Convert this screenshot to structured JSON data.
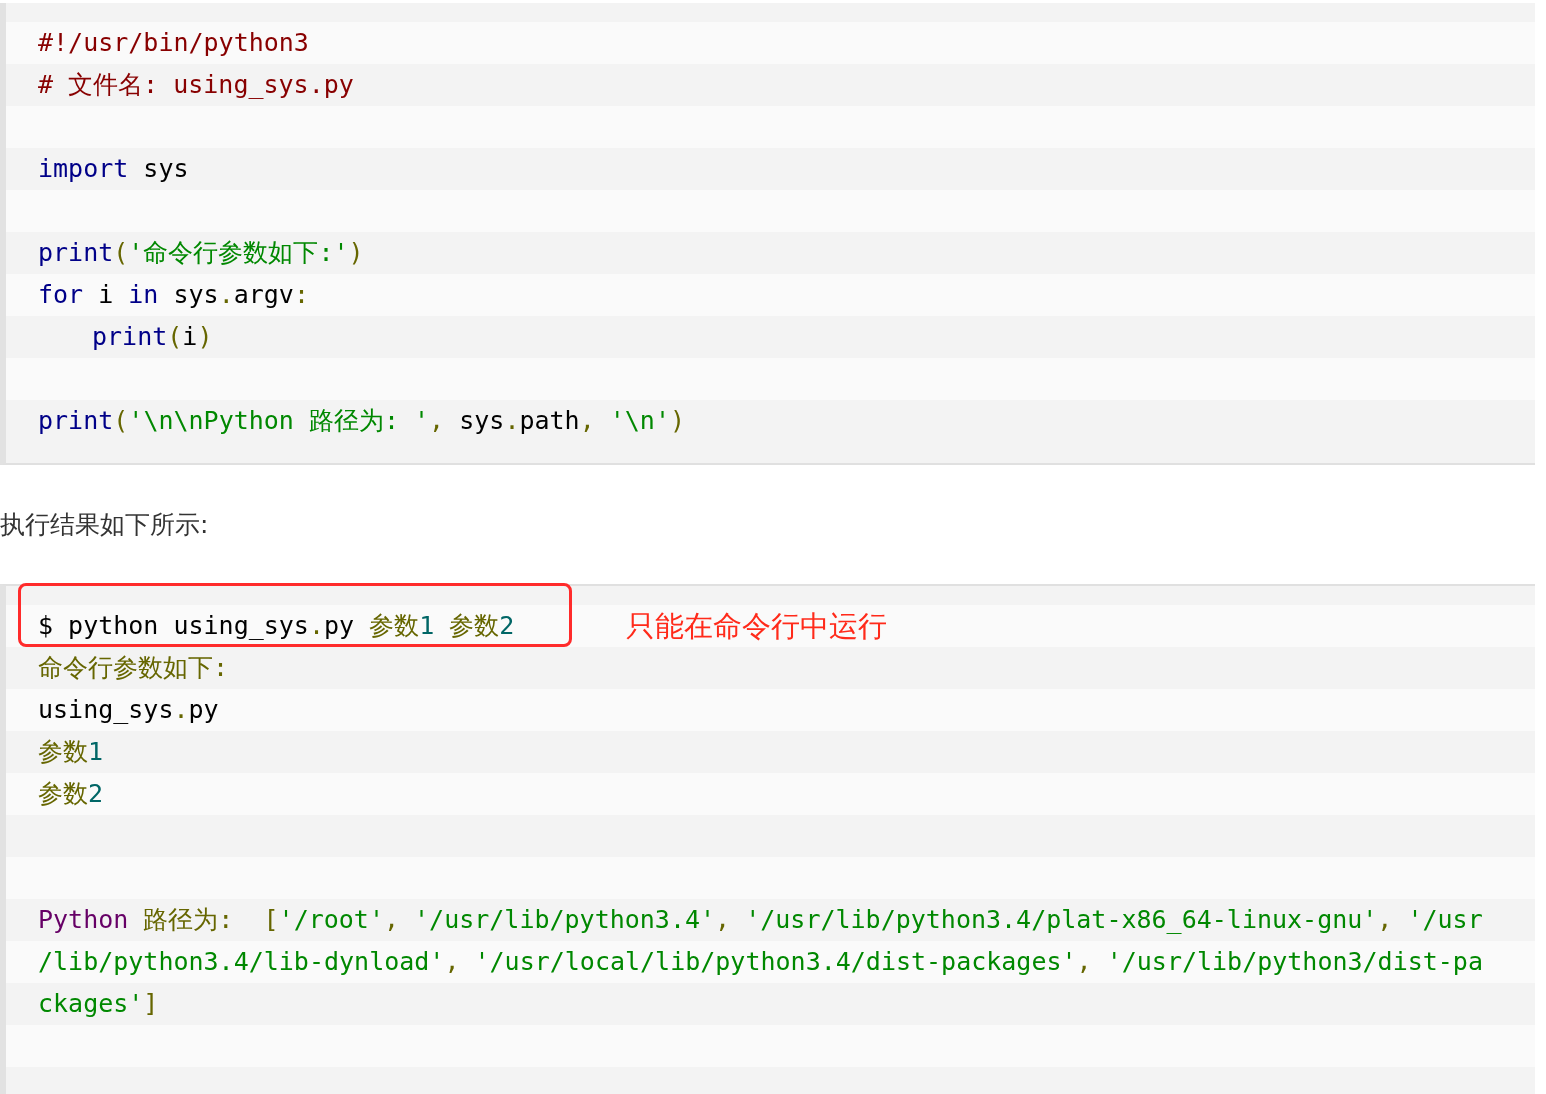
{
  "source_code": {
    "lines": [
      {
        "kind": "code",
        "tokens": [
          {
            "text": "#!/usr/bin/python3",
            "kind": "com"
          }
        ]
      },
      {
        "kind": "code",
        "tokens": [
          {
            "text": "# 文件名: using_sys.py",
            "kind": "com"
          }
        ]
      },
      {
        "kind": "blank"
      },
      {
        "kind": "code",
        "tokens": [
          {
            "text": "import",
            "kind": "kwd"
          },
          {
            "text": " sys",
            "kind": "pln"
          }
        ]
      },
      {
        "kind": "blank"
      },
      {
        "kind": "code",
        "tokens": [
          {
            "text": "print",
            "kind": "kwd"
          },
          {
            "text": "(",
            "kind": "pun"
          },
          {
            "text": "'命令行参数如下:'",
            "kind": "str"
          },
          {
            "text": ")",
            "kind": "pun"
          }
        ]
      },
      {
        "kind": "code",
        "tokens": [
          {
            "text": "for",
            "kind": "kwd"
          },
          {
            "text": " i ",
            "kind": "pln"
          },
          {
            "text": "in",
            "kind": "kwd"
          },
          {
            "text": " sys",
            "kind": "pln"
          },
          {
            "text": ".",
            "kind": "pun"
          },
          {
            "text": "argv",
            "kind": "pln"
          },
          {
            "text": ":",
            "kind": "pun"
          }
        ]
      },
      {
        "kind": "indented",
        "tokens": [
          {
            "text": "print",
            "kind": "kwd"
          },
          {
            "text": "(",
            "kind": "pun"
          },
          {
            "text": "i",
            "kind": "pln"
          },
          {
            "text": ")",
            "kind": "pun"
          }
        ]
      },
      {
        "kind": "blank"
      },
      {
        "kind": "code",
        "tokens": [
          {
            "text": "print",
            "kind": "kwd"
          },
          {
            "text": "(",
            "kind": "pun"
          },
          {
            "text": "'\\n\\nPython 路径为: '",
            "kind": "str"
          },
          {
            "text": ", ",
            "kind": "pun"
          },
          {
            "text": "sys",
            "kind": "pln"
          },
          {
            "text": ".",
            "kind": "pun"
          },
          {
            "text": "path",
            "kind": "pln"
          },
          {
            "text": ", ",
            "kind": "pun"
          },
          {
            "text": "'\\n'",
            "kind": "str"
          },
          {
            "text": ")",
            "kind": "pun"
          }
        ]
      }
    ]
  },
  "paragraph": "执行结果如下所示:",
  "output": {
    "annotation": "只能在命令行中运行",
    "lines": [
      {
        "kind": "code",
        "boxed": true,
        "tokens": [
          {
            "text": "$ python using_sys",
            "kind": "pln"
          },
          {
            "text": ".",
            "kind": "pun"
          },
          {
            "text": "py ",
            "kind": "pln"
          },
          {
            "text": "参数",
            "kind": "pun"
          },
          {
            "text": "1 ",
            "kind": "lit"
          },
          {
            "text": "参数",
            "kind": "pun"
          },
          {
            "text": "2",
            "kind": "lit"
          }
        ]
      },
      {
        "kind": "code",
        "boxed": false,
        "tokens": [
          {
            "text": "命令行参数如下:",
            "kind": "pun"
          }
        ]
      },
      {
        "kind": "code",
        "boxed": false,
        "tokens": [
          {
            "text": "using_sys",
            "kind": "pln"
          },
          {
            "text": ".",
            "kind": "pun"
          },
          {
            "text": "py",
            "kind": "pln"
          }
        ]
      },
      {
        "kind": "code",
        "boxed": false,
        "tokens": [
          {
            "text": "参数",
            "kind": "pun"
          },
          {
            "text": "1",
            "kind": "lit"
          }
        ]
      },
      {
        "kind": "code",
        "boxed": false,
        "tokens": [
          {
            "text": "参数",
            "kind": "pun"
          },
          {
            "text": "2",
            "kind": "lit"
          }
        ]
      },
      {
        "kind": "blank"
      },
      {
        "kind": "blank"
      },
      {
        "kind": "code",
        "boxed": false,
        "tokens": [
          {
            "text": "Python ",
            "kind": "typ"
          },
          {
            "text": "路径为:  [",
            "kind": "pun"
          },
          {
            "text": "'/root'",
            "kind": "str"
          },
          {
            "text": ", ",
            "kind": "pun"
          },
          {
            "text": "'/usr/lib/python3.4'",
            "kind": "str"
          },
          {
            "text": ", ",
            "kind": "pun"
          },
          {
            "text": "'/usr/lib/python3.4/plat-x86_64-linux-gnu'",
            "kind": "str"
          },
          {
            "text": ", ",
            "kind": "pun"
          },
          {
            "text": "'/usr",
            "kind": "str"
          }
        ]
      },
      {
        "kind": "code",
        "boxed": false,
        "tokens": [
          {
            "text": "/lib/python3.4/lib-dynload'",
            "kind": "str"
          },
          {
            "text": ", ",
            "kind": "pun"
          },
          {
            "text": "'/usr/local/lib/python3.4/dist-packages'",
            "kind": "str"
          },
          {
            "text": ", ",
            "kind": "pun"
          },
          {
            "text": "'/usr/lib/python3/dist-pa",
            "kind": "str"
          }
        ]
      },
      {
        "kind": "code",
        "boxed": false,
        "tokens": [
          {
            "text": "ckages'",
            "kind": "str"
          },
          {
            "text": "]",
            "kind": "pun"
          }
        ]
      },
      {
        "kind": "blank"
      },
      {
        "kind": "blank"
      }
    ]
  }
}
